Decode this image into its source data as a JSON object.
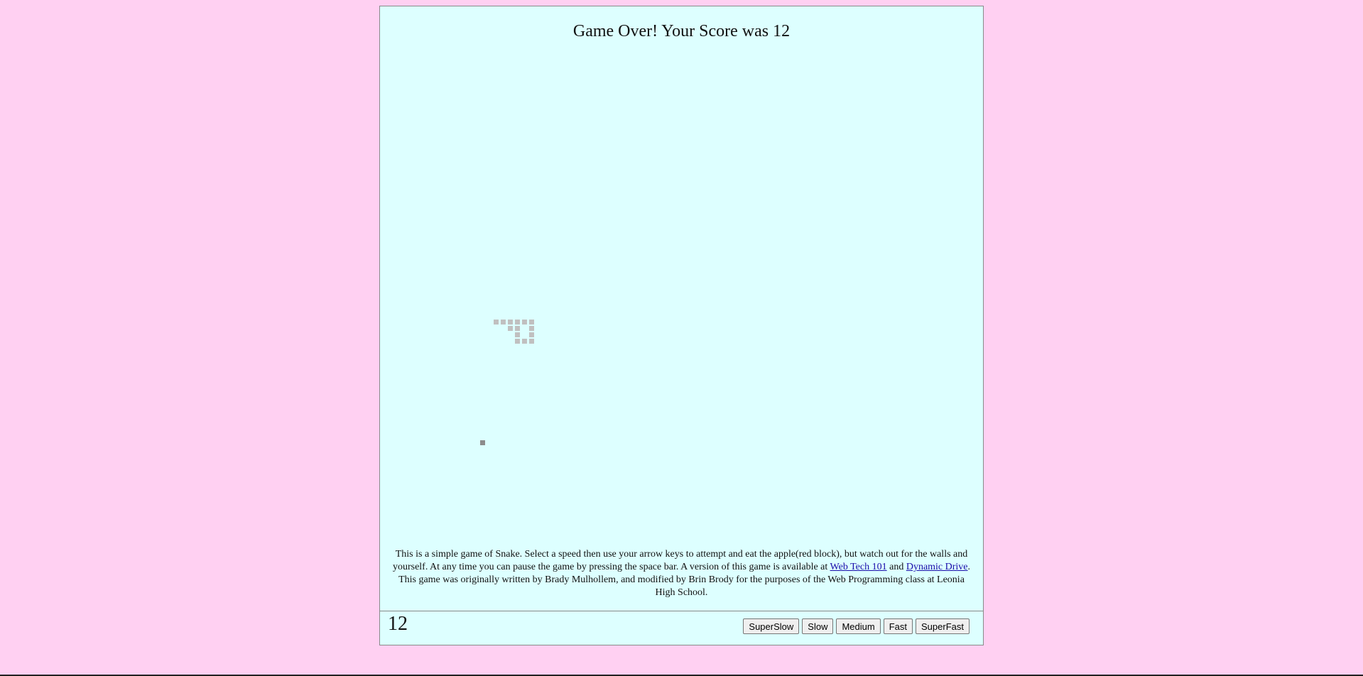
{
  "page": {
    "background_color": "#ffd0f2",
    "panel_color": "#ddffff"
  },
  "game": {
    "status_message": "Game Over! Your Score was 12",
    "score": "12",
    "snake_color": "#c0c0c0",
    "food_color": "#8c8c8c"
  },
  "description": {
    "text_before_link1": "This is a simple game of Snake. Select a speed then use your arrow keys to attempt and eat the apple(red block), but watch out for the walls and yourself. At any time you can pause the game by pressing the space bar. A version of this game is available at ",
    "link1": "Web Tech 101",
    "between_links": " and ",
    "link2": "Dynamic Drive",
    "text_after_link2": ". This game was originally written by Brady Mulhollem, and modified by Brin Brody for the purposes of the Web Programming class at Leonia High School."
  },
  "speed_buttons": {
    "superslow": "SuperSlow",
    "slow": "Slow",
    "medium": "Medium",
    "fast": "Fast",
    "superfast": "SuperFast"
  }
}
